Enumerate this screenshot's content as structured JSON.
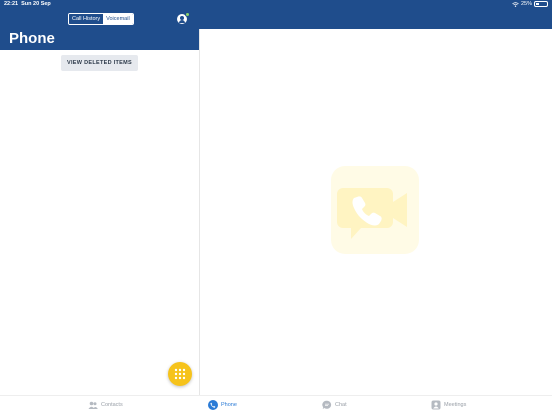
{
  "status_bar": {
    "time": "22:21",
    "date": "Sun 20 Sep",
    "battery_text": "25%",
    "battery_level": 0.25
  },
  "header": {
    "segment_tabs": [
      {
        "label": "Call History",
        "selected": true
      },
      {
        "label": "Voicemail",
        "selected": false
      }
    ],
    "title": "Phone",
    "presence_color": "#8ed36b"
  },
  "list": {
    "view_deleted_label": "VIEW DELETED ITEMS"
  },
  "tab_bar": {
    "tabs": [
      {
        "label": "Contacts",
        "icon": "contacts-icon",
        "active": false
      },
      {
        "label": "Phone",
        "icon": "phone-icon",
        "active": true
      },
      {
        "label": "Chat",
        "icon": "chat-icon",
        "active": false
      },
      {
        "label": "Meetings",
        "icon": "meetings-icon",
        "active": false
      }
    ]
  },
  "colors": {
    "brand": "#1f4d8c",
    "accent": "#2b7bd6",
    "fab": "#f6c31b",
    "placeholder": "#fffbe6"
  },
  "icons": {
    "dialpad": "dialpad-icon",
    "empty_state": "video-call-icon"
  }
}
